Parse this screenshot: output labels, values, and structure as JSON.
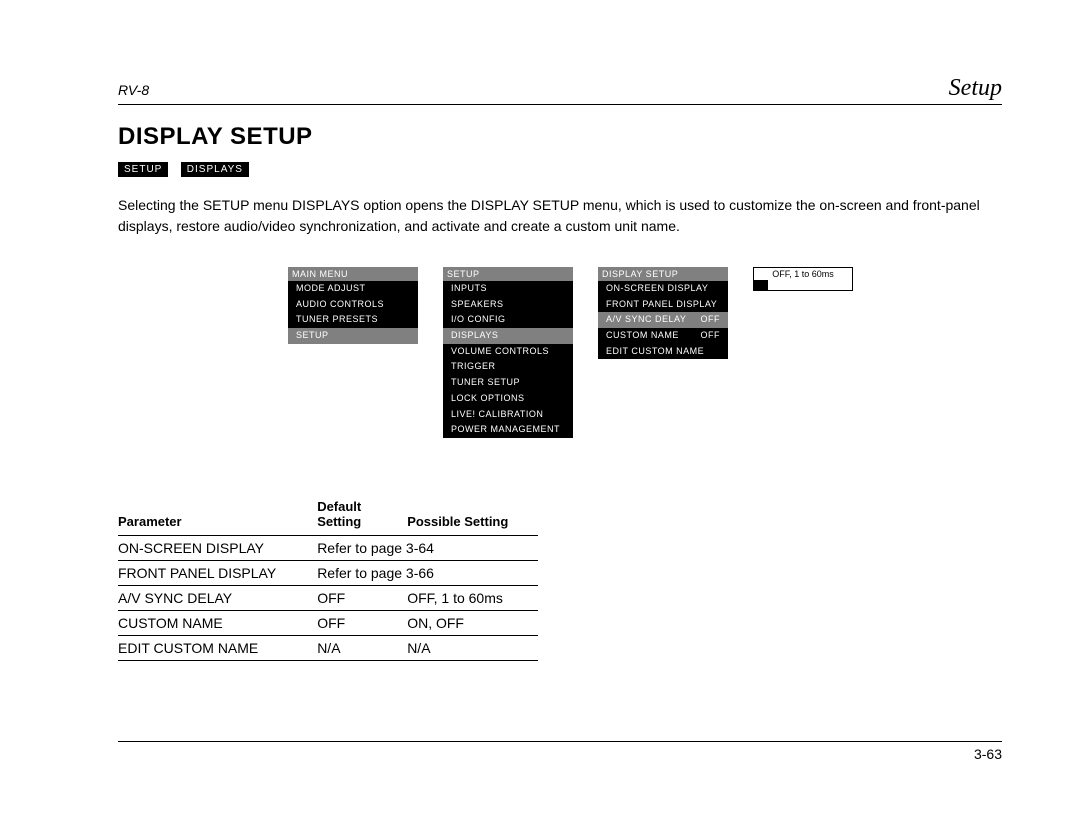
{
  "header": {
    "model": "RV-8",
    "section": "Setup"
  },
  "heading": "DISPLAY SETUP",
  "breadcrumb": {
    "a": "SETUP",
    "b": "DISPLAYS"
  },
  "description": "Selecting the SETUP menu DISPLAYS option opens the DISPLAY SETUP menu, which is used to customize the on-screen and front-panel displays, restore audio/video synchronization, and activate and create a custom unit name.",
  "menus": {
    "main": {
      "title": "MAIN MENU",
      "items": [
        "MODE ADJUST",
        "AUDIO CONTROLS",
        "TUNER PRESETS",
        "SETUP"
      ],
      "selected": 3
    },
    "setup": {
      "title": "SETUP",
      "items": [
        "INPUTS",
        "SPEAKERS",
        "I/O CONFIG",
        "DISPLAYS",
        "VOLUME CONTROLS",
        "TRIGGER",
        "TUNER SETUP",
        "LOCK OPTIONS",
        "LIVE! CALIBRATION",
        "POWER MANAGEMENT"
      ],
      "selected": 3
    },
    "display": {
      "title": "DISPLAY SETUP",
      "items": [
        {
          "label": "ON-SCREEN DISPLAY",
          "val": ""
        },
        {
          "label": "FRONT PANEL DISPLAY",
          "val": ""
        },
        {
          "label": "A/V SYNC DELAY",
          "val": "OFF"
        },
        {
          "label": "CUSTOM NAME",
          "val": "OFF"
        },
        {
          "label": "EDIT CUSTOM NAME",
          "val": ""
        }
      ],
      "selected": 2
    },
    "slider": {
      "label": "OFF, 1 to 60ms"
    }
  },
  "table": {
    "headers": {
      "param": "Parameter",
      "def": "Default Setting",
      "poss": "Possible Setting"
    },
    "rows": [
      {
        "param": "ON-SCREEN DISPLAY",
        "def": "Refer to page 3-64",
        "poss": "",
        "span": true
      },
      {
        "param": "FRONT PANEL DISPLAY",
        "def": "Refer to page 3-66",
        "poss": "",
        "span": true
      },
      {
        "param": "A/V SYNC DELAY",
        "def": "OFF",
        "poss": "OFF, 1 to 60ms"
      },
      {
        "param": "CUSTOM NAME",
        "def": "OFF",
        "poss": "ON, OFF"
      },
      {
        "param": "EDIT CUSTOM NAME",
        "def": "N/A",
        "poss": "N/A"
      }
    ]
  },
  "footer": {
    "page": "3-63"
  }
}
